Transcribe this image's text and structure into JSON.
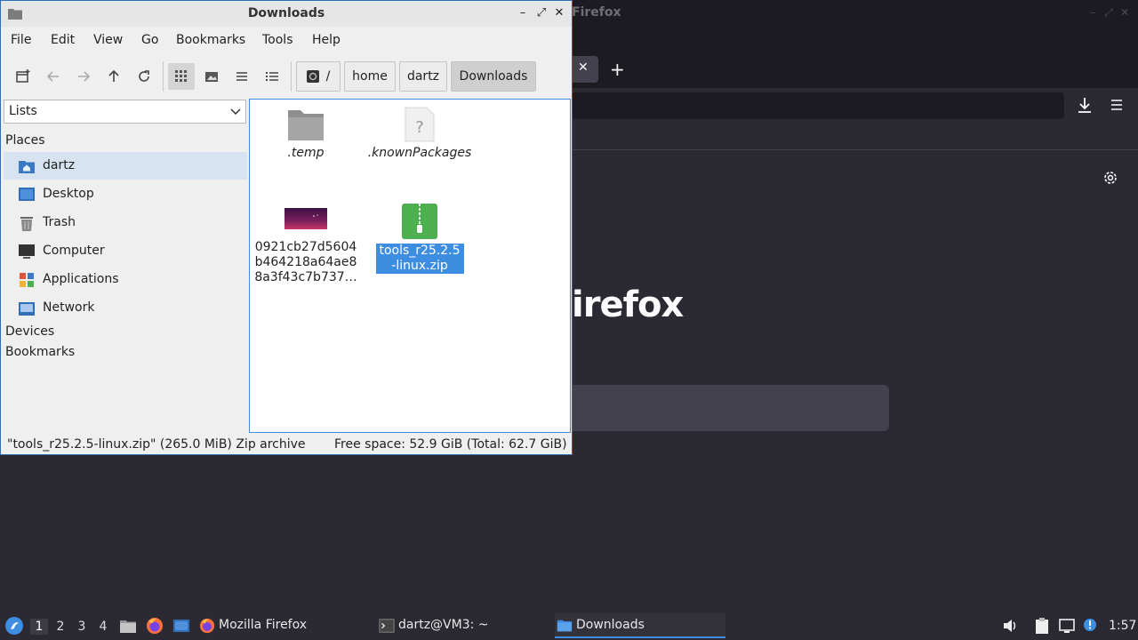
{
  "firefox": {
    "title": "Firefox",
    "brand_partial": "irefox",
    "tab_close": "✕",
    "new_tab": "+"
  },
  "window": {
    "title": "Downloads",
    "minimize": "–",
    "maximize": "⤢",
    "close": "✕"
  },
  "menubar": [
    "File",
    "Edit",
    "View",
    "Go",
    "Bookmarks",
    "Tools",
    "Help"
  ],
  "breadcrumb": {
    "root": "/",
    "items": [
      "home",
      "dartz",
      "Downloads"
    ]
  },
  "sidepanel": {
    "combo_value": "Lists",
    "places_heading": "Places",
    "places": [
      "dartz",
      "Desktop",
      "Trash",
      "Computer",
      "Applications",
      "Network"
    ],
    "devices_heading": "Devices",
    "bookmarks_heading": "Bookmarks"
  },
  "files": [
    {
      "name": ".temp",
      "type": "folder"
    },
    {
      "name": ".knownPackages",
      "type": "unknown"
    },
    {
      "name": "0921cb27d5604b464218a64ae88a3f43c7b737…",
      "type": "image"
    },
    {
      "name": "tools_r25.2.5-linux.zip",
      "type": "zip",
      "selected": true
    }
  ],
  "statusbar": {
    "selection": "\"tools_r25.2.5-linux.zip\" (265.0 MiB) Zip archive",
    "free_space": "Free space: 52.9 GiB (Total: 62.7 GiB)"
  },
  "taskbar": {
    "workspaces": [
      "1",
      "2",
      "3",
      "4"
    ],
    "tasks": [
      "Mozilla Firefox",
      "dartz@VM3: ~",
      "Downloads"
    ],
    "clock": "1:57"
  },
  "colors": {
    "accent": "#3d8ee0",
    "firefox_bg": "#2b2a33",
    "taskbar_bg": "#2b2a33"
  }
}
